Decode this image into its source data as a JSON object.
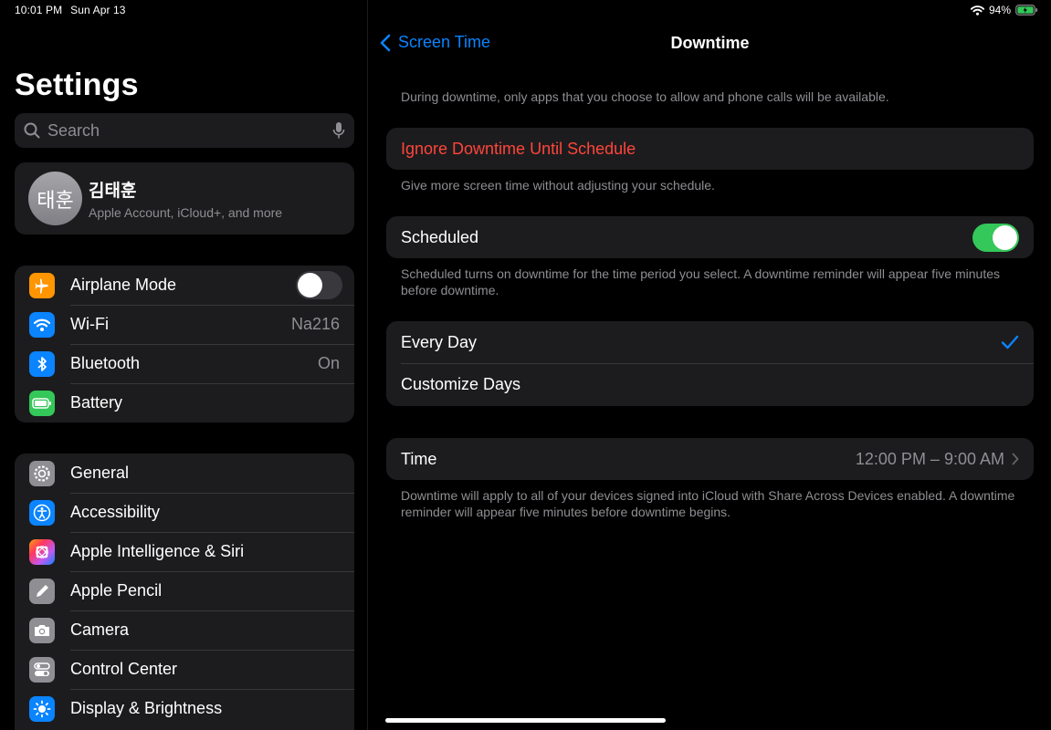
{
  "status": {
    "time": "10:01 PM",
    "date": "Sun Apr 13",
    "battery": "94%"
  },
  "sidebar": {
    "title": "Settings",
    "search": {
      "placeholder": "Search"
    },
    "profile": {
      "initials": "태훈",
      "name": "김태훈",
      "subtitle": "Apple Account, iCloud+, and more"
    },
    "group1": [
      {
        "label": "Airplane Mode",
        "icon": "airplane-icon",
        "color": "#ff9500",
        "toggle": "off"
      },
      {
        "label": "Wi-Fi",
        "icon": "wifi-icon",
        "color": "#0a84ff",
        "value": "Na216"
      },
      {
        "label": "Bluetooth",
        "icon": "bluetooth-icon",
        "color": "#0a84ff",
        "value": "On"
      },
      {
        "label": "Battery",
        "icon": "battery-icon",
        "color": "#34c759"
      }
    ],
    "group2": [
      {
        "label": "General",
        "icon": "gear-icon",
        "color": "#8e8e93"
      },
      {
        "label": "Accessibility",
        "icon": "accessibility-icon",
        "color": "#0a84ff"
      },
      {
        "label": "Apple Intelligence & Siri",
        "icon": "siri-icon",
        "color": "#7d5cf0"
      },
      {
        "label": "Apple Pencil",
        "icon": "pencil-icon",
        "color": "#8e8e93"
      },
      {
        "label": "Camera",
        "icon": "camera-icon",
        "color": "#8e8e93"
      },
      {
        "label": "Control Center",
        "icon": "control-center-icon",
        "color": "#8e8e93"
      },
      {
        "label": "Display & Brightness",
        "icon": "sun-icon",
        "color": "#0a84ff"
      }
    ]
  },
  "detail": {
    "back_label": "Screen Time",
    "title": "Downtime",
    "intro": "During downtime, only apps that you choose to allow and phone calls will be available.",
    "ignore_label": "Ignore Downtime Until Schedule",
    "ignore_footer": "Give more screen time without adjusting your schedule.",
    "scheduled_label": "Scheduled",
    "scheduled_toggle": "on",
    "scheduled_footer": "Scheduled turns on downtime for the time period you select. A downtime reminder will appear five minutes before downtime.",
    "every_day": "Every Day",
    "customize_days": "Customize Days",
    "time_label": "Time",
    "time_value": "12:00 PM – 9:00 AM",
    "time_footer": "Downtime will apply to all of your devices signed into iCloud with Share Across Devices enabled. A downtime reminder will appear five minutes before downtime begins."
  }
}
